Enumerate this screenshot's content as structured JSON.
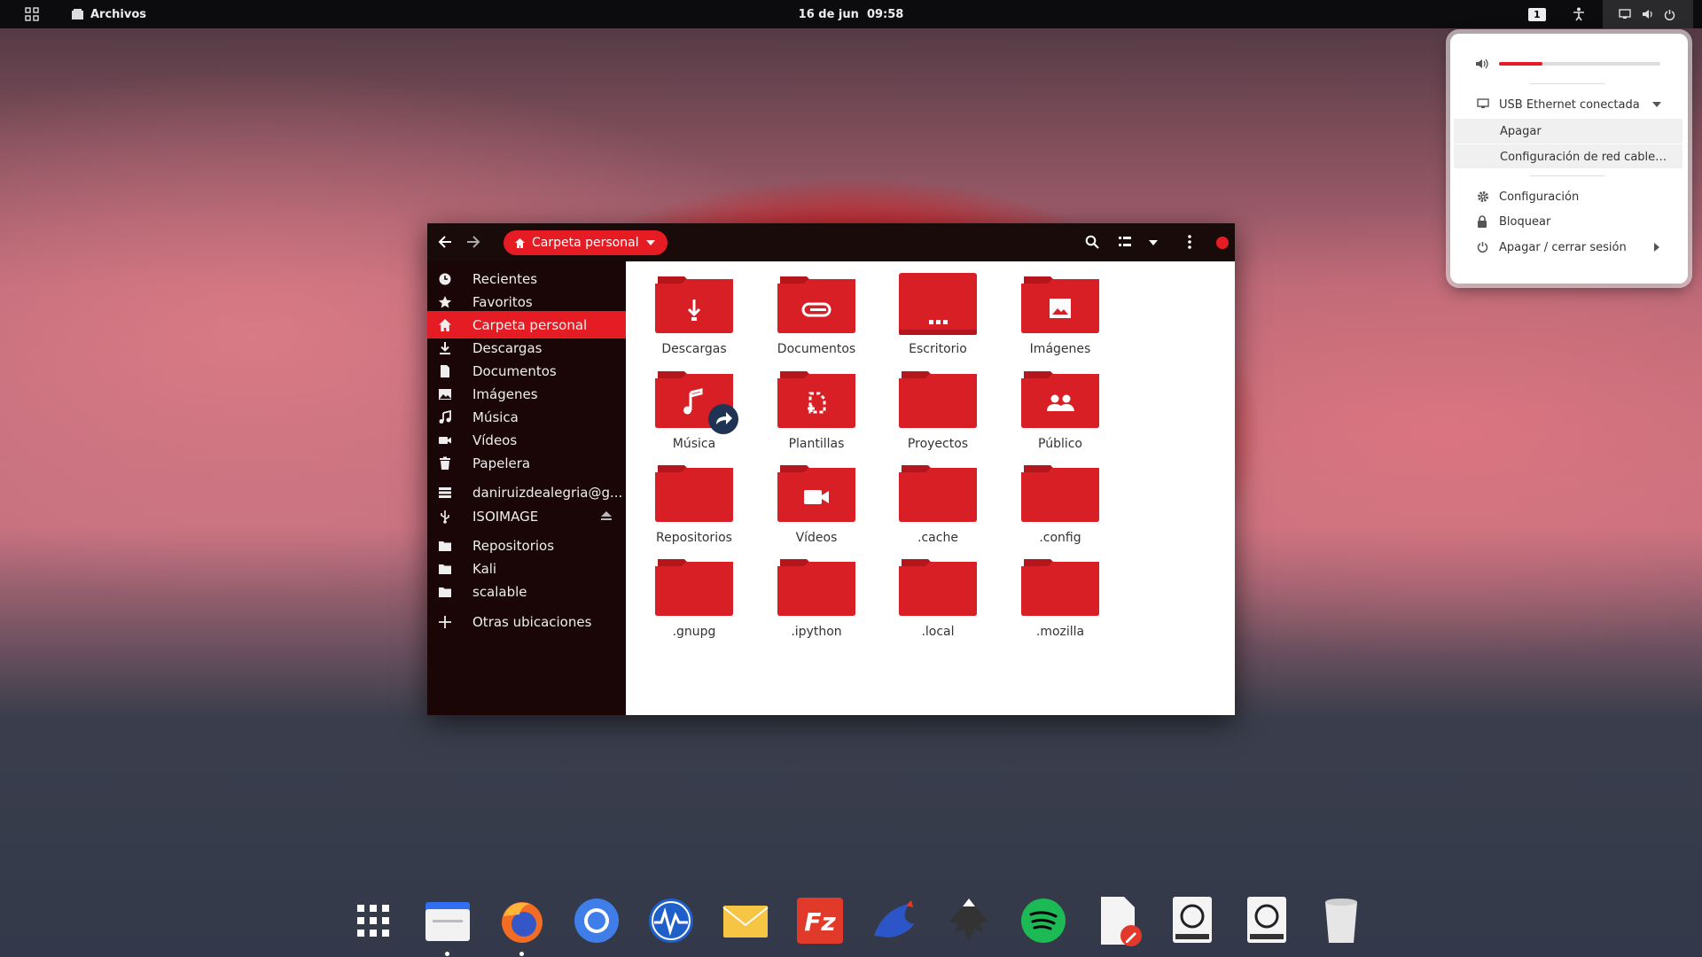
{
  "topbar": {
    "app_name": "Archivos",
    "clock": "16 de jun  09:58",
    "workspace": "1"
  },
  "window": {
    "location": "Carpeta personal",
    "sidebar": [
      {
        "label": "Recientes",
        "icon": "clock-icon"
      },
      {
        "label": "Favoritos",
        "icon": "star-icon"
      },
      {
        "label": "Carpeta personal",
        "icon": "home-icon",
        "active": true
      },
      {
        "label": "Descargas",
        "icon": "download-icon"
      },
      {
        "label": "Documentos",
        "icon": "document-icon"
      },
      {
        "label": "Imágenes",
        "icon": "image-icon"
      },
      {
        "label": "Música",
        "icon": "music-icon"
      },
      {
        "label": "Vídeos",
        "icon": "video-icon"
      },
      {
        "label": "Papelera",
        "icon": "trash-icon"
      },
      {
        "label": "daniruizdealegria@g...",
        "icon": "network-drive-icon"
      },
      {
        "label": "ISOIMAGE",
        "icon": "usb-icon"
      },
      {
        "label": "Repositorios",
        "icon": "folder-icon"
      },
      {
        "label": "Kali",
        "icon": "folder-icon"
      },
      {
        "label": "scalable",
        "icon": "folder-icon"
      },
      {
        "label": "Otras ubicaciones",
        "icon": "plus-icon"
      }
    ],
    "folders": [
      {
        "name": "Descargas",
        "emblem": "download"
      },
      {
        "name": "Documentos",
        "emblem": "paperclip"
      },
      {
        "name": "Escritorio",
        "emblem": "desktop"
      },
      {
        "name": "Imágenes",
        "emblem": "image"
      },
      {
        "name": "Música",
        "emblem": "music"
      },
      {
        "name": "Plantillas",
        "emblem": "template"
      },
      {
        "name": "Proyectos",
        "emblem": "none"
      },
      {
        "name": "Público",
        "emblem": "people"
      },
      {
        "name": "Repositorios",
        "emblem": "none"
      },
      {
        "name": "Vídeos",
        "emblem": "video"
      },
      {
        "name": ".cache",
        "emblem": "none"
      },
      {
        "name": ".config",
        "emblem": "none"
      },
      {
        "name": ".gnupg",
        "emblem": "none"
      },
      {
        "name": ".ipython",
        "emblem": "none"
      },
      {
        "name": ".local",
        "emblem": "none"
      },
      {
        "name": ".mozilla",
        "emblem": "none"
      }
    ]
  },
  "system_menu": {
    "volume_level": 0.27,
    "network_label": "USB Ethernet conectada",
    "network_items": [
      "Apagar",
      "Configuración de red cable…"
    ],
    "settings_label": "Configuración",
    "lock_label": "Bloquear",
    "power_label": "Apagar / cerrar sesión"
  },
  "dock": [
    "app-grid-icon",
    "files-icon",
    "firefox-icon",
    "chromium-icon",
    "monitor-icon",
    "mail-icon",
    "filezilla-icon",
    "kali-dragon-icon",
    "inkscape-icon",
    "spotify-icon",
    "text-editor-icon",
    "drive-icon",
    "drive-icon",
    "trash-bin-icon"
  ],
  "colors": {
    "accent": "#e51c23",
    "folder": "#d81f26",
    "folder_tab": "#b5161c",
    "sidebar_bg": "#1a0606",
    "header_bg": "#1a0b0b"
  }
}
